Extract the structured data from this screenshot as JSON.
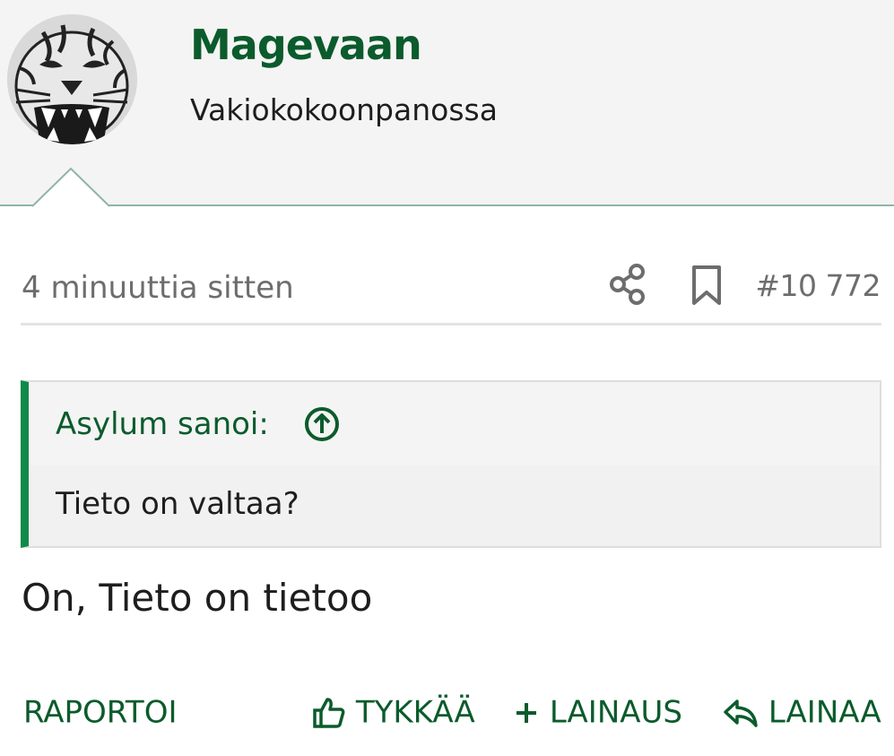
{
  "user": {
    "name": "Magevaan",
    "title": "Vakiokokoonpanossa",
    "avatar_icon": "tiger-avatar"
  },
  "post": {
    "time": "4 minuuttia sitten",
    "number": "#10 772",
    "share_icon": "share-icon",
    "bookmark_icon": "bookmark-icon",
    "quote": {
      "author": "Asylum sanoi:",
      "text": "Tieto on valtaa?",
      "jump_icon": "arrow-up-circle-icon"
    },
    "text": "On, Tieto on tietoo"
  },
  "actions": {
    "report": "RAPORTOI",
    "like": "TYKKÄÄ",
    "multiquote": "LAINAUS",
    "reply": "LAINAA"
  },
  "colors": {
    "brand_green": "#0b5b2c",
    "accent_green": "#0f8a4a",
    "header_bg": "#f4f4f4",
    "muted_text": "#6d6d6d"
  }
}
